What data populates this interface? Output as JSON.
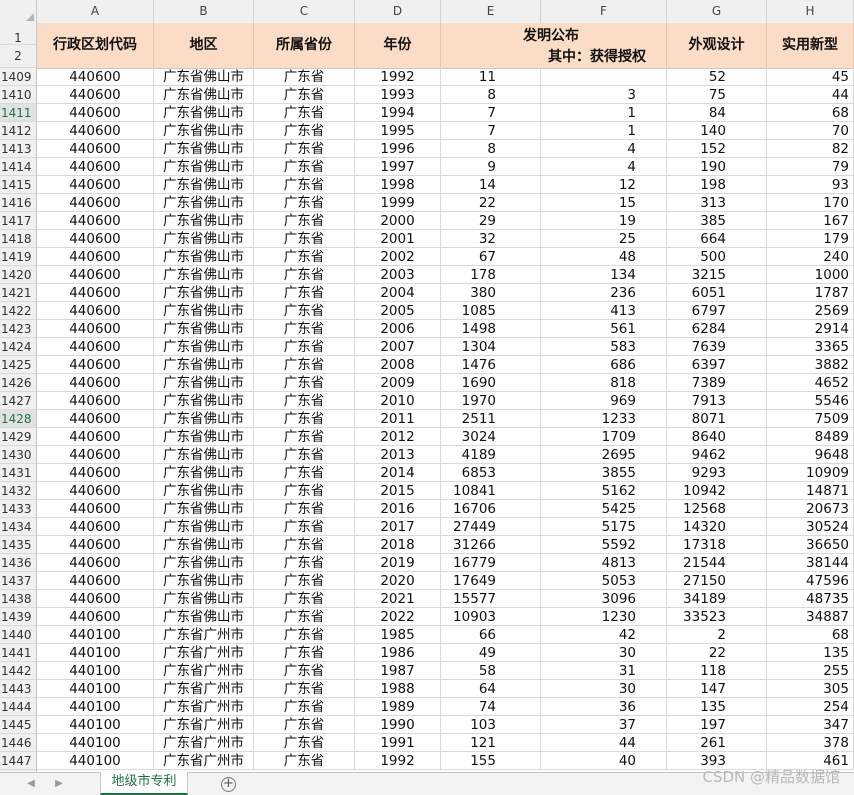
{
  "columns": [
    "A",
    "B",
    "C",
    "D",
    "E",
    "F",
    "G",
    "H"
  ],
  "header": {
    "code": "行政区划代码",
    "region": "地区",
    "province": "所属省份",
    "year": "年份",
    "invention_pub": "发明公布",
    "invention_granted": "其中：获得授权",
    "design": "外观设计",
    "utility": "实用新型"
  },
  "header_rows": [
    "1",
    "2"
  ],
  "selected_rows": [
    "1411",
    "1428"
  ],
  "rows": [
    [
      "1409",
      "440600",
      "广东省佛山市",
      "广东省",
      "1992",
      "11",
      "",
      "52",
      "45"
    ],
    [
      "1410",
      "440600",
      "广东省佛山市",
      "广东省",
      "1993",
      "8",
      "3",
      "75",
      "44"
    ],
    [
      "1411",
      "440600",
      "广东省佛山市",
      "广东省",
      "1994",
      "7",
      "1",
      "84",
      "68"
    ],
    [
      "1412",
      "440600",
      "广东省佛山市",
      "广东省",
      "1995",
      "7",
      "1",
      "140",
      "70"
    ],
    [
      "1413",
      "440600",
      "广东省佛山市",
      "广东省",
      "1996",
      "8",
      "4",
      "152",
      "82"
    ],
    [
      "1414",
      "440600",
      "广东省佛山市",
      "广东省",
      "1997",
      "9",
      "4",
      "190",
      "79"
    ],
    [
      "1415",
      "440600",
      "广东省佛山市",
      "广东省",
      "1998",
      "14",
      "12",
      "198",
      "93"
    ],
    [
      "1416",
      "440600",
      "广东省佛山市",
      "广东省",
      "1999",
      "22",
      "15",
      "313",
      "170"
    ],
    [
      "1417",
      "440600",
      "广东省佛山市",
      "广东省",
      "2000",
      "29",
      "19",
      "385",
      "167"
    ],
    [
      "1418",
      "440600",
      "广东省佛山市",
      "广东省",
      "2001",
      "32",
      "25",
      "664",
      "179"
    ],
    [
      "1419",
      "440600",
      "广东省佛山市",
      "广东省",
      "2002",
      "67",
      "48",
      "500",
      "240"
    ],
    [
      "1420",
      "440600",
      "广东省佛山市",
      "广东省",
      "2003",
      "178",
      "134",
      "3215",
      "1000"
    ],
    [
      "1421",
      "440600",
      "广东省佛山市",
      "广东省",
      "2004",
      "380",
      "236",
      "6051",
      "1787"
    ],
    [
      "1422",
      "440600",
      "广东省佛山市",
      "广东省",
      "2005",
      "1085",
      "413",
      "6797",
      "2569"
    ],
    [
      "1423",
      "440600",
      "广东省佛山市",
      "广东省",
      "2006",
      "1498",
      "561",
      "6284",
      "2914"
    ],
    [
      "1424",
      "440600",
      "广东省佛山市",
      "广东省",
      "2007",
      "1304",
      "583",
      "7639",
      "3365"
    ],
    [
      "1425",
      "440600",
      "广东省佛山市",
      "广东省",
      "2008",
      "1476",
      "686",
      "6397",
      "3882"
    ],
    [
      "1426",
      "440600",
      "广东省佛山市",
      "广东省",
      "2009",
      "1690",
      "818",
      "7389",
      "4652"
    ],
    [
      "1427",
      "440600",
      "广东省佛山市",
      "广东省",
      "2010",
      "1970",
      "969",
      "7913",
      "5546"
    ],
    [
      "1428",
      "440600",
      "广东省佛山市",
      "广东省",
      "2011",
      "2511",
      "1233",
      "8071",
      "7509"
    ],
    [
      "1429",
      "440600",
      "广东省佛山市",
      "广东省",
      "2012",
      "3024",
      "1709",
      "8640",
      "8489"
    ],
    [
      "1430",
      "440600",
      "广东省佛山市",
      "广东省",
      "2013",
      "4189",
      "2695",
      "9462",
      "9648"
    ],
    [
      "1431",
      "440600",
      "广东省佛山市",
      "广东省",
      "2014",
      "6853",
      "3855",
      "9293",
      "10909"
    ],
    [
      "1432",
      "440600",
      "广东省佛山市",
      "广东省",
      "2015",
      "10841",
      "5162",
      "10942",
      "14871"
    ],
    [
      "1433",
      "440600",
      "广东省佛山市",
      "广东省",
      "2016",
      "16706",
      "5425",
      "12568",
      "20673"
    ],
    [
      "1434",
      "440600",
      "广东省佛山市",
      "广东省",
      "2017",
      "27449",
      "5175",
      "14320",
      "30524"
    ],
    [
      "1435",
      "440600",
      "广东省佛山市",
      "广东省",
      "2018",
      "31266",
      "5592",
      "17318",
      "36650"
    ],
    [
      "1436",
      "440600",
      "广东省佛山市",
      "广东省",
      "2019",
      "16779",
      "4813",
      "21544",
      "38144"
    ],
    [
      "1437",
      "440600",
      "广东省佛山市",
      "广东省",
      "2020",
      "17649",
      "5053",
      "27150",
      "47596"
    ],
    [
      "1438",
      "440600",
      "广东省佛山市",
      "广东省",
      "2021",
      "15577",
      "3096",
      "34189",
      "48735"
    ],
    [
      "1439",
      "440600",
      "广东省佛山市",
      "广东省",
      "2022",
      "10903",
      "1230",
      "33523",
      "34887"
    ],
    [
      "1440",
      "440100",
      "广东省广州市",
      "广东省",
      "1985",
      "66",
      "42",
      "2",
      "68"
    ],
    [
      "1441",
      "440100",
      "广东省广州市",
      "广东省",
      "1986",
      "49",
      "30",
      "22",
      "135"
    ],
    [
      "1442",
      "440100",
      "广东省广州市",
      "广东省",
      "1987",
      "58",
      "31",
      "118",
      "255"
    ],
    [
      "1443",
      "440100",
      "广东省广州市",
      "广东省",
      "1988",
      "64",
      "30",
      "147",
      "305"
    ],
    [
      "1444",
      "440100",
      "广东省广州市",
      "广东省",
      "1989",
      "74",
      "36",
      "135",
      "254"
    ],
    [
      "1445",
      "440100",
      "广东省广州市",
      "广东省",
      "1990",
      "103",
      "37",
      "197",
      "347"
    ],
    [
      "1446",
      "440100",
      "广东省广州市",
      "广东省",
      "1991",
      "121",
      "44",
      "261",
      "378"
    ],
    [
      "1447",
      "440100",
      "广东省广州市",
      "广东省",
      "1992",
      "155",
      "40",
      "393",
      "461"
    ]
  ],
  "sheet_tab": "地级市专利",
  "add_sheet_icon": "plus-circle-icon",
  "nav_icons": [
    "prev-sheet-icon",
    "next-sheet-icon"
  ],
  "watermark": "CSDN @精品数据馆",
  "colors": {
    "header_fill": "#fbdcc6",
    "accent": "#217346"
  }
}
